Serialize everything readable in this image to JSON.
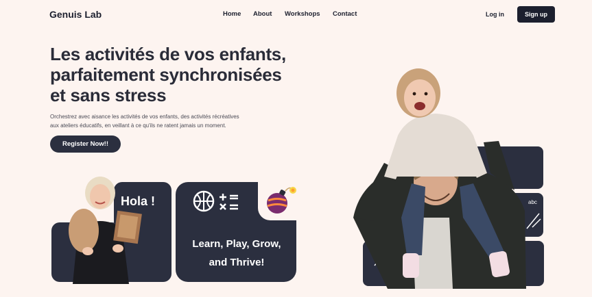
{
  "nav": {
    "brand": "Genuis Lab",
    "links": [
      "Home",
      "About",
      "Workshops",
      "Contact"
    ],
    "login": "Log in",
    "signup": "Sign up"
  },
  "hero": {
    "title_lines": [
      "Les activités de vos enfants,",
      "parfaitement synchronisées",
      "et sans stress"
    ],
    "description_lines": [
      "Orchestrez avec aisance les activités de vos enfants, des activités récréatives",
      "aux ateliers éducatifs, en veillant à ce qu'ils ne ratent jamais un moment."
    ],
    "cta": "Register Now!!"
  },
  "cards": {
    "hola": "Hola !",
    "tagline_lines": [
      "Learn, Play, Grow,",
      "and Thrive!"
    ]
  },
  "colors": {
    "background": "#fdf4f0",
    "dark": "#2b2f3f",
    "text": "#1c1f2e"
  }
}
